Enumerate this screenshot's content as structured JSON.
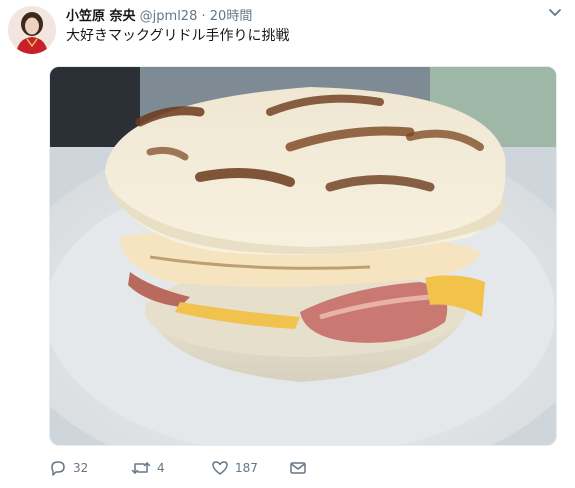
{
  "tweet": {
    "display_name": "小笠原 奈央",
    "handle": "@jpml28",
    "separator": "·",
    "time": "20時間",
    "text": "大好きマックグリドル手作りに挑戦",
    "image_icon": "homemade-griddle-sandwich-photo"
  },
  "actions": {
    "reply_count": "32",
    "retweet_count": "4",
    "like_count": "187",
    "reply_icon": "reply-icon",
    "retweet_icon": "retweet-icon",
    "like_icon": "heart-icon",
    "dm_icon": "envelope-icon"
  },
  "colors": {
    "text_primary": "#14171a",
    "text_secondary": "#657786",
    "border": "#e6ecf0"
  }
}
